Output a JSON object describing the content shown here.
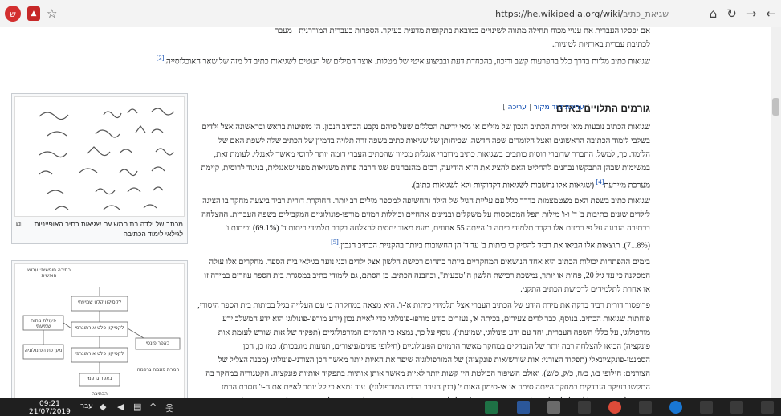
{
  "browser": {
    "tab_title": "שגיאת כתיב",
    "url_host": "https://he.wikipedia.org/wiki/",
    "url_path": "שגיאת_כתיב",
    "ext_label": "ש"
  },
  "article": {
    "top_line": "אם יפסקו העברית את ענויי מכוח תחילה מתווה לשינויים כמובאת בתקופות מדעית בעיקר. הספרות בעברית המודרנית - מעבר",
    "top_line2": "לכתיבת עברית באותיות לטיניות.",
    "intro": "שגיאות כתיב מלוות בדרך כלל בהפרעות קשב וריכוז, בהכחדת דעת ובביצוע איטי של מטלות. אוצר המילים של הנוטים לשגיאות כתיב דל מזה של שאר האוכלוסייה.",
    "intro_ref": "[3]",
    "section_heading": "גורמים התלויים באדם",
    "edit_source": "עריכת קוד מקור",
    "edit": "עריכה",
    "p1": "שגיאות הכתיב נובעות מאי זכירת הכתיב הנכון של מילים או מאי ידיעת הכללים שעל פיהם נקבע הכתיב הנכון. הן מופיעות בראש ובראשונה אצל ילדים בשלבי לימוד הכתיבה הראשונים ואצל הלומדים שפה חדשה. שכיחותן של שגיאות כתיב בשפה זרה תלויה בדמיון של הכתיב שלה לשפת האם של הלומד. כך, למשל, התברר שדוברי רוסית כותבים בשגיאות כתיב מדוברי אנגלית מכיוון שהכתיב העברי דומה יותר לרוסי מאשר לאנגלי. לעומת זאת, במשימות שבהן התבקשו נבחנים להחליט האם להציג את ה\"א הידיעה, רבים מהנבחנים שגו הרבה פחות משגיאות מפני שאנגלית, בניגוד לרוסית, קיימת מערכת מיידעת",
    "p1_ref": "[4]",
    "p1_tail": "(שגיאות אלו נחשבות לשגיאות דקדוקיות ולא לשגיאות כתיב).",
    "p2": "שגיאות כתיב בשפת האם מצטמצמות בדרך כלל עם עליית הגיל של הילד והחשיפה למספר מילים רב יותר. החוקרת דורית רביד ביצעה מחקר בו הציגה לילדים שונים כתיבות ב' ד' ו-ו' מילות תפל המבוססות על משקלים ובניינים אהחיים וכוללות רמזים מורפו-פונולוגיים המקבילים בשפה העברית. ההצלחה בכתיבה הנכונה על פי רמזים אלו בקרב תלמידי כיתה ב' הייתה 55 אחוזים, מעט מאוד יחסית להצלחה בקרב תלמידי כיתות ד' (69.1%) וכיתות ו' (71.8%). תוצאות אלו הביאו את רביד להסיק כי כיתות ב' עד ד' הן החשובות ביותר בהקניית הכתיב הנכון.",
    "p2_ref": "[5]",
    "p3": "בימים ההפתחות יכולות הכתיב היא אחד הנושאים המחקריים ביותר בתחום רכישת הלשון אצל ילדים ובני נוער בגילאי בית הספר. מחקרים אלו עולה המסקנה כי עד גיל 20, פחות או יותר, נמשכת רכישת הלשון ה\"טבעית\", ובהבנה הכתיב. כן הסתם, גם לימודי כתיב במסגרת בית הספר עוזרים במידה זו או אחרת לתלמידים לרכישת הכתיב התקני.",
    "p4": "פרופסור דורית רביד בדקה את מידת הידע של הכתיב העברי אצל תלמידי כיתות א'-ו'. היא מצאה במחקרה כי עם העלייה בגיל בכיתות בית הספר היסודי, פוחתות שגיאות הכתיב. בנוסף, כבר לדים צעירים, בכיתה א', נעזרים בידע מורפו-פונולוגי כדי לאיית נכון (ידע מורפו-פונולוגי הוא ידע המשלב ידע מורפולוגי, על כללי השפה העברית, יחד עם ידע פונולוגי, שמיעתי). נוסף על כך, נמצא כי הרמזים המורפולוגיים (תפקיד של אות שורש לעומת אות פונקציה) הביאו להצלחה רבה יותר של הנבדקים במחקר מאשר הרמזים הפונולוגיים (חילופי פונים/עיצורים, תנועות מוגבכות). כמו כן, הכן הסמנטי-פונקציונאלי (תפקוד הצורני: אות שורש/אות פונקציה) של המורפולוגיה שיפר את האיות יותר מאשר הכן הצורני-פונולוגי (מבנה הצליל של הצורנים: חילופי ב/ו, כ/ח, כ/ק, ס/ש). ואולם השיפור הבולטת היו קשות יותר לאיות מאשר אותן אותיות בתפקיד אותיות פונקציה. הקטגוריה במחקר בה התקשו בעיקר הנבדקים במחקר הייתה סימון או אי-סימון האות י' (בגין העדר הרמז המורפולוגי). עוד נמצא כי קל יותר לאיית את ה-י' חסרת הרמז המורפולוגי במקומה (למשל: ליפול, ניגש) מאשר בהיעדרה (למשל, לספור, מגרש). הממצאים כולם מורים על חשיבותם של גורמים פורפולוגים ומורפו-פונולוגיים בהתפתחות ידע הכתיב בעברית.",
    "fig1_caption": "מכתב של ילדה בת חמש עם שגיאות כתיב האופייניות לגילאי לימוד הכתיבה",
    "fig2_labels": [
      "כתיבה חופשית: ערוש חופשית",
      "לקסיקון קלט שמיעתי",
      "לקסיקון פלט אורתוגרפי",
      "פעולת ניתוח שמיעתי",
      "מערכת הפונולוגיה",
      "לקסיקון פלט אורתוגרפי",
      "באפר פונטי",
      "באפר גרפמי",
      "המרת פונמה גרפמה",
      "הכתיבה"
    ]
  },
  "taskbar": {
    "time": "09:21",
    "date": "21/07/2019",
    "lang": "עבר"
  }
}
